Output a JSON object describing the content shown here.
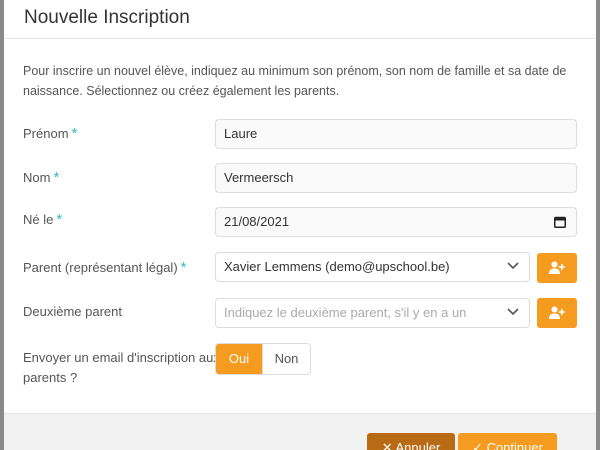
{
  "modal": {
    "title": "Nouvelle Inscription",
    "intro": "Pour inscrire un nouvel élève, indiquez au minimum son prénom, son nom de famille et sa date de naissance. Sélectionnez ou créez également les parents."
  },
  "form": {
    "required_mark": "*",
    "prenom": {
      "label": "Prénom",
      "value": "Laure"
    },
    "nom": {
      "label": "Nom",
      "value": "Vermeersch"
    },
    "ne_le": {
      "label": "Né le",
      "value": "21/08/2021"
    },
    "parent": {
      "label": "Parent (représentant légal)",
      "value": "Xavier Lemmens (demo@upschool.be)"
    },
    "deuxieme_parent": {
      "label": "Deuxième parent",
      "placeholder": "Indiquez le deuxième parent, s'il y en a un"
    },
    "email": {
      "label": "Envoyer un email d'inscription aux parents ?",
      "yes": "Oui",
      "no": "Non",
      "selected": "Oui"
    }
  },
  "footer": {
    "cancel_label": "✕ Annuler",
    "submit_label": "✓ Continuer"
  },
  "colors": {
    "accent": "#f59b20",
    "required": "#35b9c6",
    "cancel": "#b86a14"
  },
  "icons": [
    "chevron-down-icon",
    "calendar-icon",
    "add-user-icon"
  ]
}
